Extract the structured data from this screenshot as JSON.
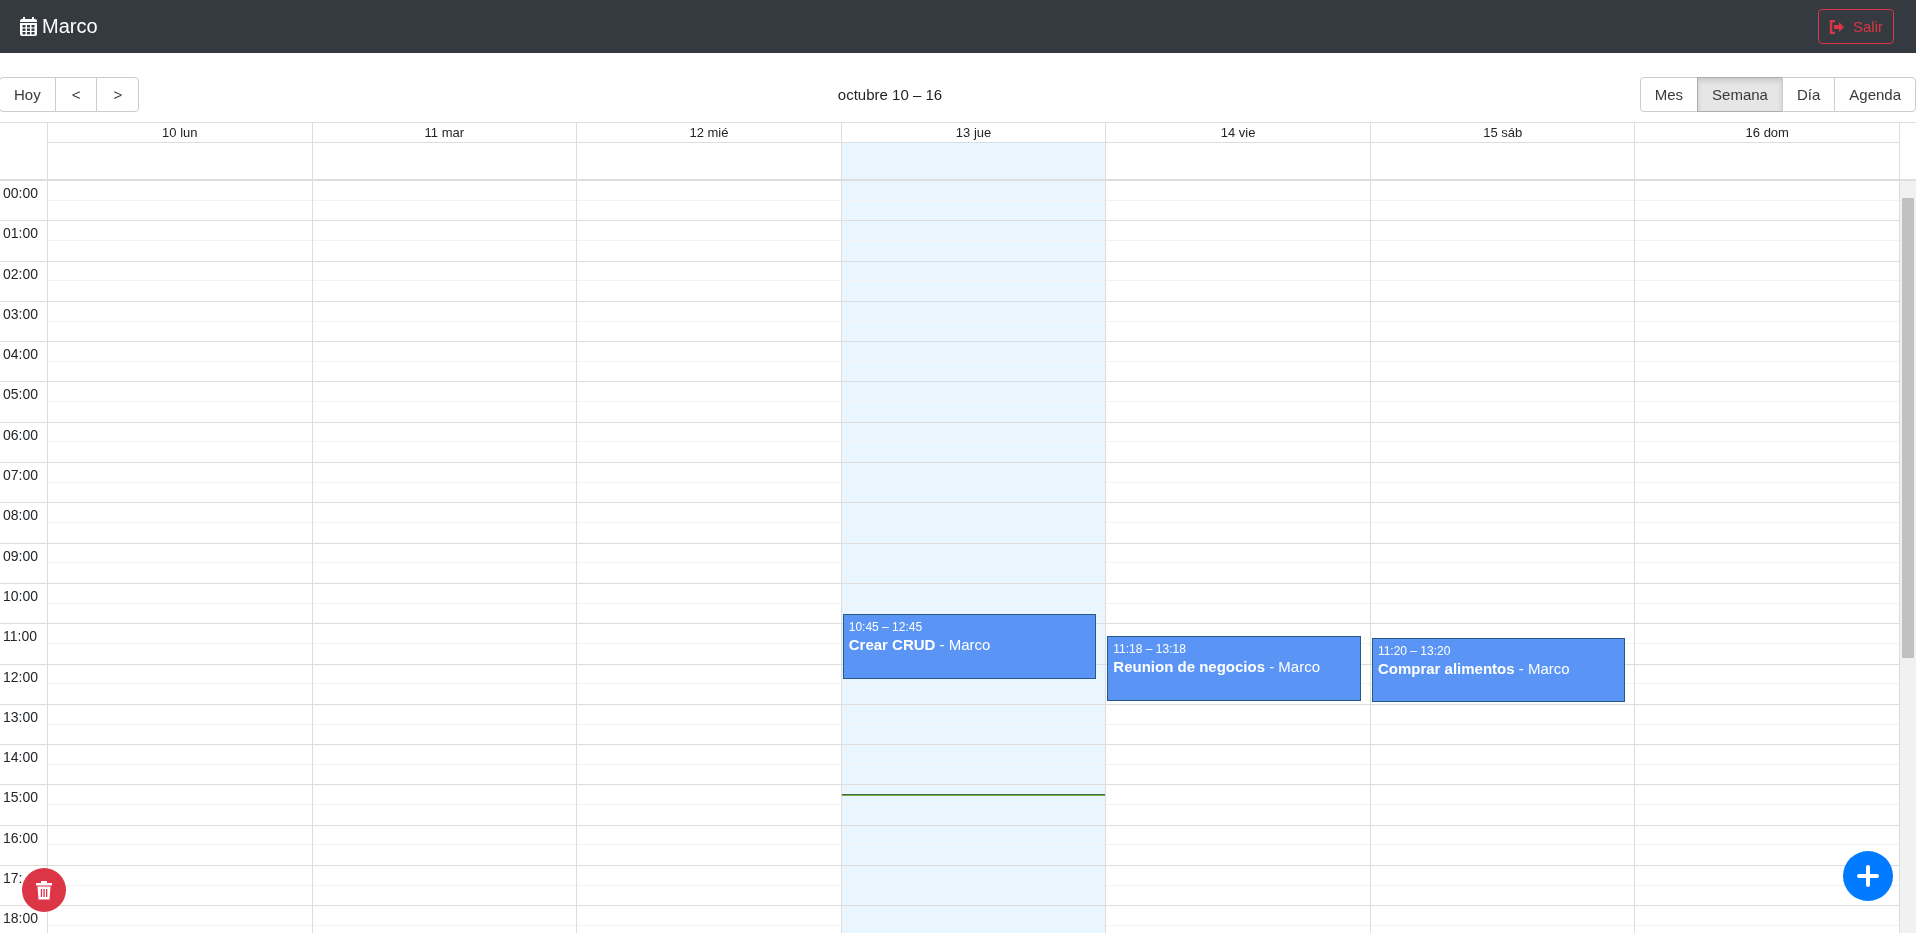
{
  "navbar": {
    "brand": "Marco",
    "logout_button": "Salir"
  },
  "toolbar": {
    "nav_buttons": [
      "Hoy",
      "<",
      ">"
    ],
    "range_label": "octubre 10 – 16",
    "views": [
      {
        "label": "Mes",
        "selected": false
      },
      {
        "label": "Semana",
        "selected": true
      },
      {
        "label": "Día",
        "selected": false
      },
      {
        "label": "Agenda",
        "selected": false
      }
    ]
  },
  "days": [
    {
      "label": "10 lun",
      "today": false
    },
    {
      "label": "11 mar",
      "today": false
    },
    {
      "label": "12 mié",
      "today": false
    },
    {
      "label": "13 jue",
      "today": true,
      "events": [
        {
          "time": "10:45 – 12:45",
          "title": "**Crear CRUD** - Marco"
        }
      ]
    },
    {
      "label": "14 vie",
      "today": false,
      "events": [
        {
          "time": "11:18 – 13:18",
          "title": "**Reunion de negocios** - Marco"
        }
      ]
    },
    {
      "label": "15 sáb",
      "today": false,
      "events": [
        {
          "time": "11:20 – 13:20",
          "title": "**Comprar alimentos** - Marco"
        }
      ]
    },
    {
      "label": "16 dom",
      "today": false
    }
  ],
  "time_labels": [
    "00:00",
    "01:00",
    "02:00",
    "03:00",
    "04:00",
    "05:00",
    "06:00",
    "07:00",
    "08:00",
    "09:00",
    "10:00",
    "11:00",
    "12:00",
    "13:00",
    "14:00",
    "15:00",
    "16:00",
    "17:",
    "18:00"
  ]
}
